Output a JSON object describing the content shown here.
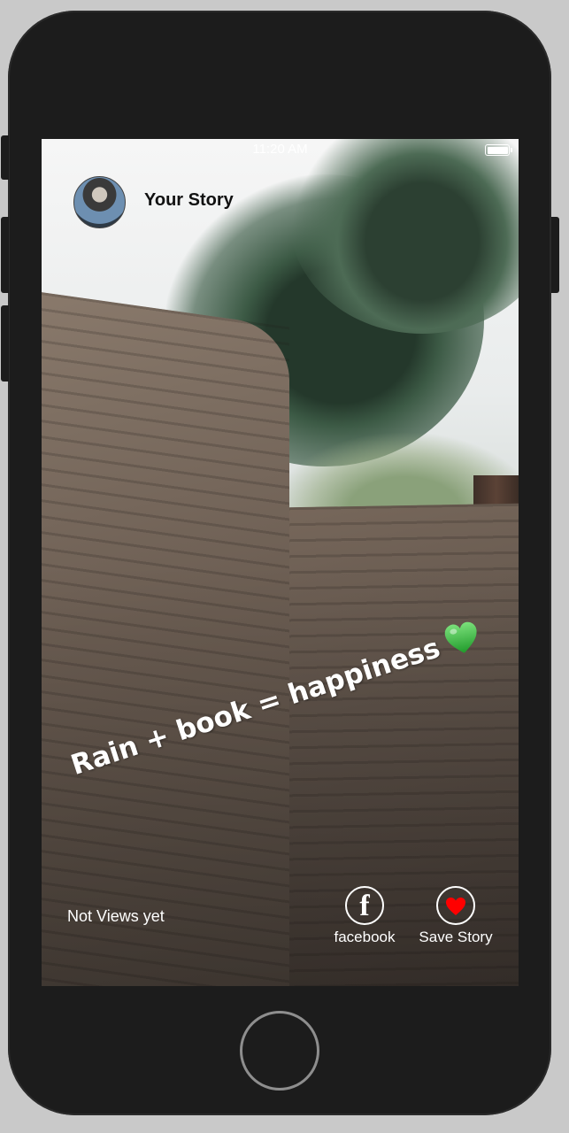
{
  "status_bar": {
    "time": "11:20 AM"
  },
  "header": {
    "title": "Your Story"
  },
  "story": {
    "caption": "Rain + book = happiness"
  },
  "footer": {
    "views_label": "Not Views yet",
    "facebook_label": "facebook",
    "save_label": "Save Story"
  },
  "colors": {
    "heart": "#ff0000",
    "green_heart": "#3cc23c"
  }
}
